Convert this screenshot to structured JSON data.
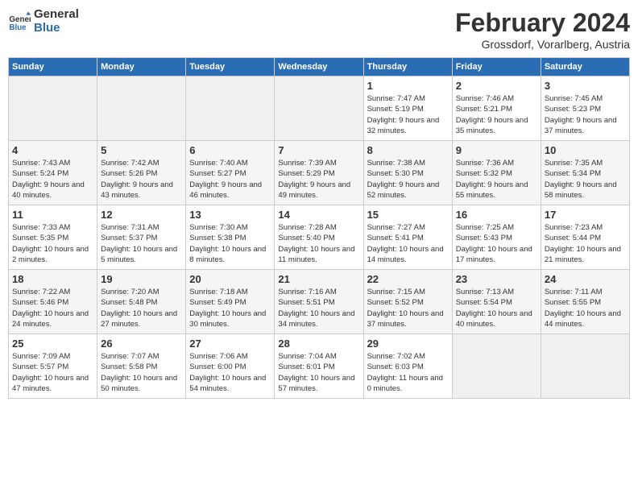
{
  "header": {
    "logo_line1": "General",
    "logo_line2": "Blue",
    "title": "February 2024",
    "subtitle": "Grossdorf, Vorarlberg, Austria"
  },
  "weekdays": [
    "Sunday",
    "Monday",
    "Tuesday",
    "Wednesday",
    "Thursday",
    "Friday",
    "Saturday"
  ],
  "weeks": [
    [
      {
        "num": "",
        "sunrise": "",
        "sunset": "",
        "daylight": ""
      },
      {
        "num": "",
        "sunrise": "",
        "sunset": "",
        "daylight": ""
      },
      {
        "num": "",
        "sunrise": "",
        "sunset": "",
        "daylight": ""
      },
      {
        "num": "",
        "sunrise": "",
        "sunset": "",
        "daylight": ""
      },
      {
        "num": "1",
        "sunrise": "Sunrise: 7:47 AM",
        "sunset": "Sunset: 5:19 PM",
        "daylight": "Daylight: 9 hours and 32 minutes."
      },
      {
        "num": "2",
        "sunrise": "Sunrise: 7:46 AM",
        "sunset": "Sunset: 5:21 PM",
        "daylight": "Daylight: 9 hours and 35 minutes."
      },
      {
        "num": "3",
        "sunrise": "Sunrise: 7:45 AM",
        "sunset": "Sunset: 5:23 PM",
        "daylight": "Daylight: 9 hours and 37 minutes."
      }
    ],
    [
      {
        "num": "4",
        "sunrise": "Sunrise: 7:43 AM",
        "sunset": "Sunset: 5:24 PM",
        "daylight": "Daylight: 9 hours and 40 minutes."
      },
      {
        "num": "5",
        "sunrise": "Sunrise: 7:42 AM",
        "sunset": "Sunset: 5:26 PM",
        "daylight": "Daylight: 9 hours and 43 minutes."
      },
      {
        "num": "6",
        "sunrise": "Sunrise: 7:40 AM",
        "sunset": "Sunset: 5:27 PM",
        "daylight": "Daylight: 9 hours and 46 minutes."
      },
      {
        "num": "7",
        "sunrise": "Sunrise: 7:39 AM",
        "sunset": "Sunset: 5:29 PM",
        "daylight": "Daylight: 9 hours and 49 minutes."
      },
      {
        "num": "8",
        "sunrise": "Sunrise: 7:38 AM",
        "sunset": "Sunset: 5:30 PM",
        "daylight": "Daylight: 9 hours and 52 minutes."
      },
      {
        "num": "9",
        "sunrise": "Sunrise: 7:36 AM",
        "sunset": "Sunset: 5:32 PM",
        "daylight": "Daylight: 9 hours and 55 minutes."
      },
      {
        "num": "10",
        "sunrise": "Sunrise: 7:35 AM",
        "sunset": "Sunset: 5:34 PM",
        "daylight": "Daylight: 9 hours and 58 minutes."
      }
    ],
    [
      {
        "num": "11",
        "sunrise": "Sunrise: 7:33 AM",
        "sunset": "Sunset: 5:35 PM",
        "daylight": "Daylight: 10 hours and 2 minutes."
      },
      {
        "num": "12",
        "sunrise": "Sunrise: 7:31 AM",
        "sunset": "Sunset: 5:37 PM",
        "daylight": "Daylight: 10 hours and 5 minutes."
      },
      {
        "num": "13",
        "sunrise": "Sunrise: 7:30 AM",
        "sunset": "Sunset: 5:38 PM",
        "daylight": "Daylight: 10 hours and 8 minutes."
      },
      {
        "num": "14",
        "sunrise": "Sunrise: 7:28 AM",
        "sunset": "Sunset: 5:40 PM",
        "daylight": "Daylight: 10 hours and 11 minutes."
      },
      {
        "num": "15",
        "sunrise": "Sunrise: 7:27 AM",
        "sunset": "Sunset: 5:41 PM",
        "daylight": "Daylight: 10 hours and 14 minutes."
      },
      {
        "num": "16",
        "sunrise": "Sunrise: 7:25 AM",
        "sunset": "Sunset: 5:43 PM",
        "daylight": "Daylight: 10 hours and 17 minutes."
      },
      {
        "num": "17",
        "sunrise": "Sunrise: 7:23 AM",
        "sunset": "Sunset: 5:44 PM",
        "daylight": "Daylight: 10 hours and 21 minutes."
      }
    ],
    [
      {
        "num": "18",
        "sunrise": "Sunrise: 7:22 AM",
        "sunset": "Sunset: 5:46 PM",
        "daylight": "Daylight: 10 hours and 24 minutes."
      },
      {
        "num": "19",
        "sunrise": "Sunrise: 7:20 AM",
        "sunset": "Sunset: 5:48 PM",
        "daylight": "Daylight: 10 hours and 27 minutes."
      },
      {
        "num": "20",
        "sunrise": "Sunrise: 7:18 AM",
        "sunset": "Sunset: 5:49 PM",
        "daylight": "Daylight: 10 hours and 30 minutes."
      },
      {
        "num": "21",
        "sunrise": "Sunrise: 7:16 AM",
        "sunset": "Sunset: 5:51 PM",
        "daylight": "Daylight: 10 hours and 34 minutes."
      },
      {
        "num": "22",
        "sunrise": "Sunrise: 7:15 AM",
        "sunset": "Sunset: 5:52 PM",
        "daylight": "Daylight: 10 hours and 37 minutes."
      },
      {
        "num": "23",
        "sunrise": "Sunrise: 7:13 AM",
        "sunset": "Sunset: 5:54 PM",
        "daylight": "Daylight: 10 hours and 40 minutes."
      },
      {
        "num": "24",
        "sunrise": "Sunrise: 7:11 AM",
        "sunset": "Sunset: 5:55 PM",
        "daylight": "Daylight: 10 hours and 44 minutes."
      }
    ],
    [
      {
        "num": "25",
        "sunrise": "Sunrise: 7:09 AM",
        "sunset": "Sunset: 5:57 PM",
        "daylight": "Daylight: 10 hours and 47 minutes."
      },
      {
        "num": "26",
        "sunrise": "Sunrise: 7:07 AM",
        "sunset": "Sunset: 5:58 PM",
        "daylight": "Daylight: 10 hours and 50 minutes."
      },
      {
        "num": "27",
        "sunrise": "Sunrise: 7:06 AM",
        "sunset": "Sunset: 6:00 PM",
        "daylight": "Daylight: 10 hours and 54 minutes."
      },
      {
        "num": "28",
        "sunrise": "Sunrise: 7:04 AM",
        "sunset": "Sunset: 6:01 PM",
        "daylight": "Daylight: 10 hours and 57 minutes."
      },
      {
        "num": "29",
        "sunrise": "Sunrise: 7:02 AM",
        "sunset": "Sunset: 6:03 PM",
        "daylight": "Daylight: 11 hours and 0 minutes."
      },
      {
        "num": "",
        "sunrise": "",
        "sunset": "",
        "daylight": ""
      },
      {
        "num": "",
        "sunrise": "",
        "sunset": "",
        "daylight": ""
      }
    ]
  ]
}
